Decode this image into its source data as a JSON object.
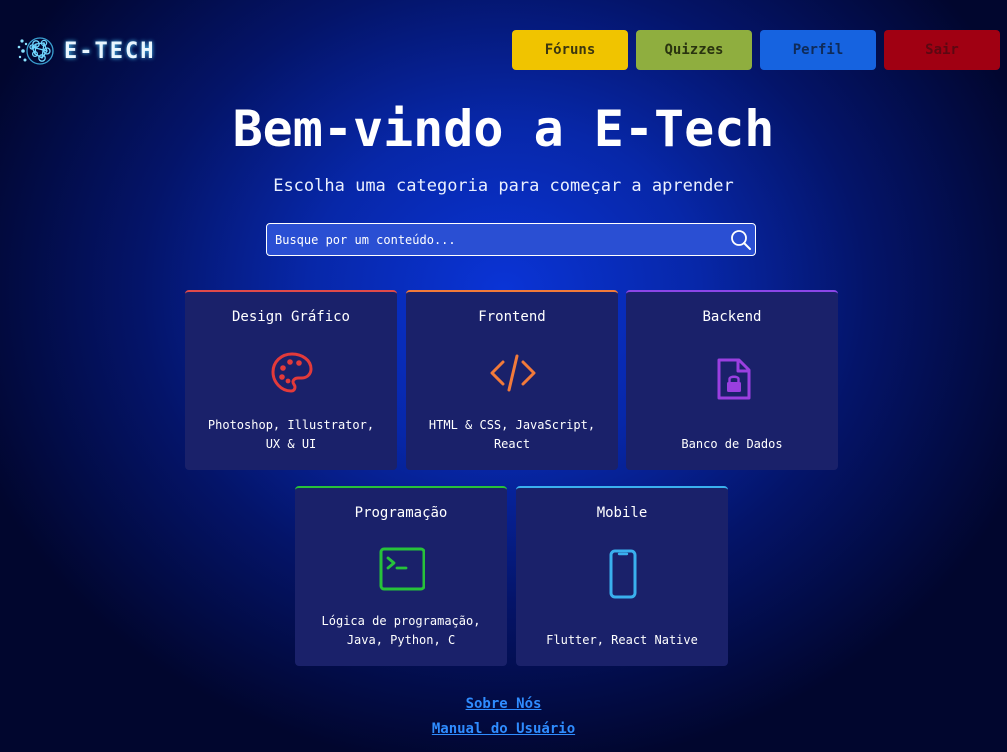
{
  "header": {
    "brand": "E-TECH",
    "nav": {
      "forums": "Fóruns",
      "quizzes": "Quizzes",
      "profile": "Perfil",
      "logout": "Sair"
    }
  },
  "hero": {
    "title": "Bem-vindo a E-Tech",
    "subtitle": "Escolha uma categoria para começar a aprender"
  },
  "search": {
    "placeholder": "Busque por um conteúdo..."
  },
  "categories": [
    {
      "title": "Design Gráfico",
      "description": "Photoshop, Illustrator, UX & UI",
      "icon": "palette-icon",
      "color": "#e04a4a"
    },
    {
      "title": "Frontend",
      "description": "HTML & CSS, JavaScript, React",
      "icon": "code-icon",
      "color": "#f27a3a"
    },
    {
      "title": "Backend",
      "description": "Banco de Dados",
      "icon": "file-lock-icon",
      "color": "#8a46e8"
    },
    {
      "title": "Programação",
      "description": "Lógica de programação, Java, Python, C",
      "icon": "terminal-icon",
      "color": "#27c23a"
    },
    {
      "title": "Mobile",
      "description": "Flutter, React Native",
      "icon": "smartphone-icon",
      "color": "#3ab0ee"
    }
  ],
  "footer": {
    "about": "Sobre Nós",
    "manual": "Manual do Usuário"
  },
  "colors": {
    "background_center": "#0a34d6",
    "background_edge": "#01062e",
    "card_bg": "#1a216a",
    "link": "#2f8cff",
    "forums_button": "#f0c400",
    "quizzes_button": "#8fae3f",
    "profile_button": "#1663e0",
    "logout_button": "#a00012"
  }
}
